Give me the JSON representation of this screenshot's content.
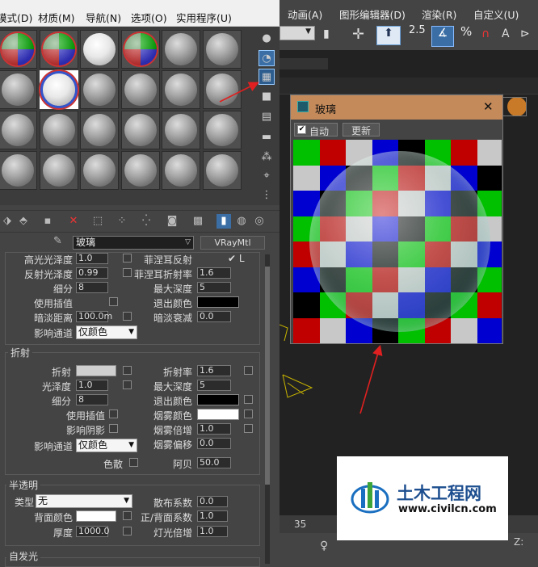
{
  "material_editor": {
    "menu": [
      "模式(D)",
      "材质(M)",
      "导航(N)",
      "选项(O)",
      "实用程序(U)"
    ],
    "material_name": "玻璃",
    "material_type": "VRayMtl",
    "reflection": {
      "rows": [
        {
          "left_label": "高光光泽度",
          "left_value": "1.0",
          "right_label": "菲涅耳反射",
          "right_value": "✔ L"
        },
        {
          "left_label": "反射光泽度",
          "left_value": "0.99",
          "right_label": "菲涅耳折射率",
          "right_value": "1.6"
        },
        {
          "left_label": "细分",
          "left_value": "8",
          "right_label": "最大深度",
          "right_value": "5"
        },
        {
          "left_label": "使用插值",
          "left_value": "",
          "right_label": "退出颜色",
          "right_value": ""
        },
        {
          "left_label": "暗淡距离",
          "left_value": "100.0m",
          "right_label": "暗淡衰减",
          "right_value": "0.0"
        },
        {
          "left_label": "影响通道",
          "left_value": "仅颜色",
          "right_label": "",
          "right_value": ""
        }
      ]
    },
    "refraction": {
      "title": "折射",
      "refract_label": "折射",
      "ior_label": "折射率",
      "ior_value": "1.6",
      "gloss_label": "光泽度",
      "gloss_value": "1.0",
      "max_depth_label": "最大深度",
      "max_depth_value": "5",
      "subdiv_label": "细分",
      "subdiv_value": "8",
      "exit_color_label": "退出颜色",
      "use_interp_label": "使用插值",
      "fog_color_label": "烟雾颜色",
      "affect_shadows_label": "影响阴影",
      "fog_mult_label": "烟雾倍增",
      "fog_mult_value": "1.0",
      "affect_channel_label": "影响通道",
      "affect_channel_value": "仅颜色",
      "fog_bias_label": "烟雾偏移",
      "fog_bias_value": "0.0",
      "dispersion_label": "色散",
      "abbe_label": "阿贝",
      "abbe_value": "50.0"
    },
    "translucency": {
      "title": "半透明",
      "type_label": "类型",
      "type_value": "无",
      "scatter_label": "散布系数",
      "scatter_value": "0.0",
      "back_color_label": "背面颜色",
      "fb_label": "正/背面系数",
      "fb_value": "1.0",
      "thickness_label": "厚度",
      "thickness_value": "1000.0",
      "light_mult_label": "灯光倍增",
      "light_mult_value": "1.0"
    },
    "self_illum_title": "自发光"
  },
  "max": {
    "menu": [
      "动画(A)",
      "图形编辑器(D)",
      "渲染(R)",
      "自定义(U)"
    ],
    "toolbar_text": [
      "2.5",
      "%"
    ],
    "timeline_number": "35"
  },
  "preview": {
    "title": "玻璃",
    "auto_label": "自动",
    "update_label": "更新",
    "close": "✕"
  },
  "watermark": {
    "cn": "土木工程网",
    "url": "www.civilcn.com"
  },
  "colors": {
    "annotation_arrow": "#e02020",
    "preview_title": "#c48a5a",
    "background": "#444444"
  }
}
